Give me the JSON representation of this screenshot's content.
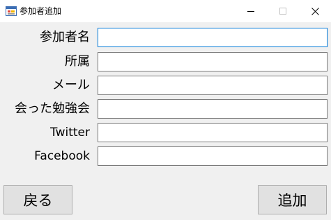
{
  "window": {
    "title": "参加者追加",
    "icons": {
      "app": "form-window-icon",
      "minimize": "minimize-icon",
      "maximize": "maximize-icon",
      "close": "close-icon"
    }
  },
  "form": {
    "fields": [
      {
        "label": "参加者名",
        "value": ""
      },
      {
        "label": "所属",
        "value": ""
      },
      {
        "label": "メール",
        "value": ""
      },
      {
        "label": "会った勉強会",
        "value": ""
      },
      {
        "label": "Twitter",
        "value": ""
      },
      {
        "label": "Facebook",
        "value": ""
      }
    ]
  },
  "actions": {
    "back_label": "戻る",
    "add_label": "追加"
  },
  "colors": {
    "background": "#f0f0f0",
    "titlebar": "#ffffff",
    "focus_border": "#0078d7",
    "button_face": "#e1e1e1"
  }
}
